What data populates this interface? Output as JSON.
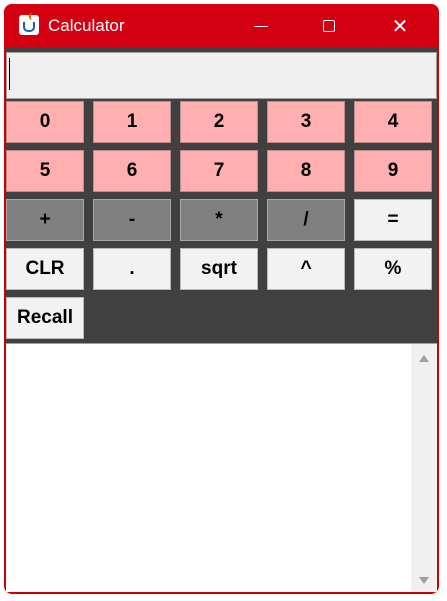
{
  "window": {
    "title": "Calculator",
    "icon": "java-cup-icon",
    "controls": [
      "minimize-icon",
      "maximize-icon",
      "close-icon"
    ],
    "close_glyph": "✕"
  },
  "display": {
    "value": ""
  },
  "keypad": {
    "digits": [
      "0",
      "1",
      "2",
      "3",
      "4",
      "5",
      "6",
      "7",
      "8",
      "9"
    ],
    "operators": [
      "+",
      "-",
      "*",
      "/"
    ],
    "equals": "=",
    "functions": [
      "CLR",
      ".",
      "sqrt",
      "^",
      "%"
    ],
    "recall": "Recall"
  },
  "history": {
    "lines": []
  },
  "colors": {
    "titlebar": "#d40012",
    "panel": "#404040",
    "digit_button": "#ffafaf",
    "operator_button": "#808080",
    "function_button": "#f2f2f2"
  }
}
